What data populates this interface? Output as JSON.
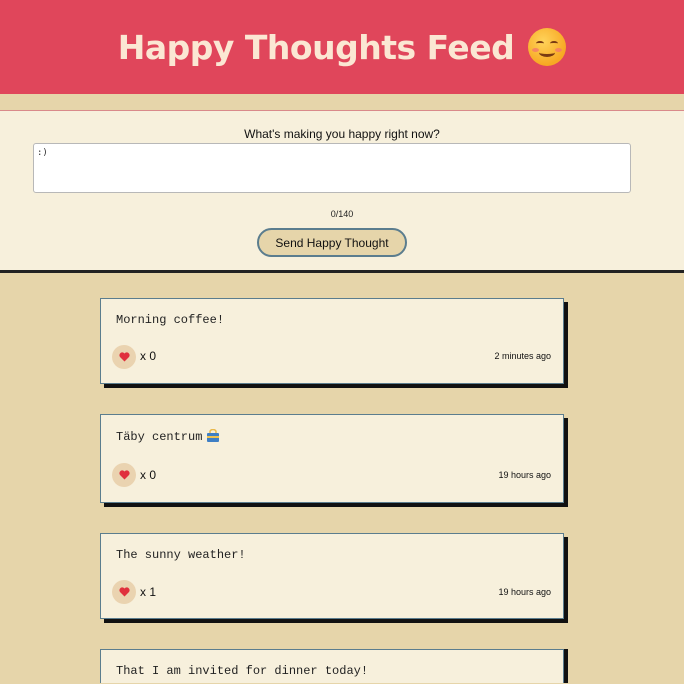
{
  "header": {
    "title": "Happy Thoughts Feed",
    "emoji_icon": "smiling-face-icon"
  },
  "form": {
    "prompt": "What's making you happy right now?",
    "input_value": ":)",
    "char_count": "0/140",
    "submit_label": "Send Happy Thought"
  },
  "thoughts": [
    {
      "message": "Morning coffee!",
      "like_prefix": "x",
      "likes": "0",
      "time": "2 minutes ago"
    },
    {
      "message": "Täby centrum",
      "icon": "shopping-bag-icon",
      "like_prefix": "x",
      "likes": "0",
      "time": "19 hours ago"
    },
    {
      "message": "The sunny weather!",
      "like_prefix": "x",
      "likes": "1",
      "time": "19 hours ago"
    },
    {
      "message": "That I am invited for dinner today!"
    }
  ],
  "colors": {
    "header_bg": "#e0465b",
    "page_bg": "#e6d5aa",
    "card_bg": "#f7f0dc",
    "card_border": "#5b7d8e",
    "heart": "#e0303d"
  }
}
